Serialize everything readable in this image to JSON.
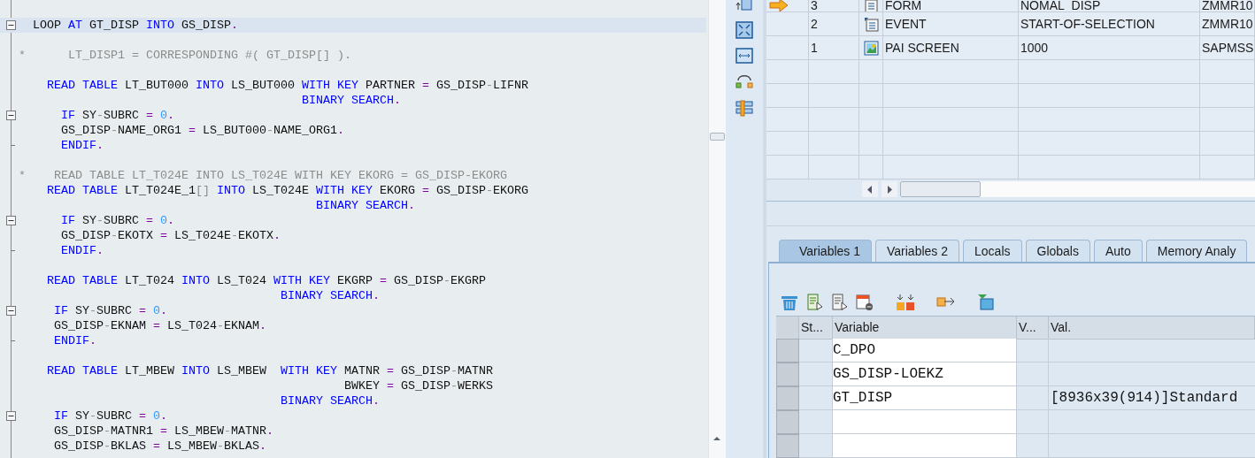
{
  "editor": {
    "lines": [
      {
        "kind": "code",
        "current": true,
        "fold_marker": true,
        "segments": [
          {
            "kind": "name",
            "text": "  LOOP "
          },
          {
            "kind": "keyword",
            "text": "AT"
          },
          {
            "kind": "name",
            "text": " GT_DISP "
          },
          {
            "kind": "keyword",
            "text": "INTO"
          },
          {
            "kind": "name",
            "text": " GS_DISP"
          },
          {
            "kind": "operator",
            "text": "."
          }
        ]
      },
      {
        "kind": "blank"
      },
      {
        "kind": "code",
        "segments": [
          {
            "kind": "comment",
            "text": "*      LT_DISP1 = CORRESPONDING #( GT_DISP[] )."
          }
        ]
      },
      {
        "kind": "blank"
      },
      {
        "kind": "code",
        "segments": [
          {
            "kind": "keyword",
            "text": "    READ TABLE"
          },
          {
            "kind": "name",
            "text": " LT_BUT000 "
          },
          {
            "kind": "keyword",
            "text": "INTO"
          },
          {
            "kind": "name",
            "text": " LS_BUT000 "
          },
          {
            "kind": "keyword",
            "text": "WITH KEY"
          },
          {
            "kind": "name",
            "text": " PARTNER "
          },
          {
            "kind": "operator",
            "text": "="
          },
          {
            "kind": "name",
            "text": " GS_DISP"
          },
          {
            "kind": "dash",
            "text": "-"
          },
          {
            "kind": "name",
            "text": "LIFNR"
          }
        ]
      },
      {
        "kind": "code",
        "segments": [
          {
            "kind": "keyword",
            "text": "                                        BINARY SEARCH"
          },
          {
            "kind": "operator",
            "text": "."
          }
        ]
      },
      {
        "kind": "code",
        "fold_marker": true,
        "segments": [
          {
            "kind": "keyword",
            "text": "      IF"
          },
          {
            "kind": "name",
            "text": " SY"
          },
          {
            "kind": "dash",
            "text": "-"
          },
          {
            "kind": "name",
            "text": "SUBRC "
          },
          {
            "kind": "operator",
            "text": "= "
          },
          {
            "kind": "number",
            "text": "0"
          },
          {
            "kind": "operator",
            "text": "."
          }
        ]
      },
      {
        "kind": "code",
        "segments": [
          {
            "kind": "name",
            "text": "      GS_DISP"
          },
          {
            "kind": "dash",
            "text": "-"
          },
          {
            "kind": "name",
            "text": "NAME_ORG1 "
          },
          {
            "kind": "operator",
            "text": "="
          },
          {
            "kind": "name",
            "text": " LS_BUT000"
          },
          {
            "kind": "dash",
            "text": "-"
          },
          {
            "kind": "name",
            "text": "NAME_ORG1"
          },
          {
            "kind": "operator",
            "text": "."
          }
        ]
      },
      {
        "kind": "code",
        "fold_end": true,
        "segments": [
          {
            "kind": "keyword",
            "text": "      ENDIF"
          },
          {
            "kind": "operator",
            "text": "."
          }
        ]
      },
      {
        "kind": "blank"
      },
      {
        "kind": "code",
        "segments": [
          {
            "kind": "comment",
            "text": "*    READ TABLE LT_T024E INTO LS_T024E WITH KEY EKORG = GS_DISP-EKORG"
          }
        ]
      },
      {
        "kind": "code",
        "segments": [
          {
            "kind": "keyword",
            "text": "    READ TABLE"
          },
          {
            "kind": "name",
            "text": " LT_T024E_1"
          },
          {
            "kind": "dash",
            "text": "[]"
          },
          {
            "kind": "keyword",
            "text": " INTO"
          },
          {
            "kind": "name",
            "text": " LS_T024E "
          },
          {
            "kind": "keyword",
            "text": "WITH KEY"
          },
          {
            "kind": "name",
            "text": " EKORG "
          },
          {
            "kind": "operator",
            "text": "="
          },
          {
            "kind": "name",
            "text": " GS_DISP"
          },
          {
            "kind": "dash",
            "text": "-"
          },
          {
            "kind": "name",
            "text": "EKORG"
          }
        ]
      },
      {
        "kind": "code",
        "segments": [
          {
            "kind": "keyword",
            "text": "                                          BINARY SEARCH"
          },
          {
            "kind": "operator",
            "text": "."
          }
        ]
      },
      {
        "kind": "code",
        "fold_marker": true,
        "segments": [
          {
            "kind": "keyword",
            "text": "      IF"
          },
          {
            "kind": "name",
            "text": " SY"
          },
          {
            "kind": "dash",
            "text": "-"
          },
          {
            "kind": "name",
            "text": "SUBRC "
          },
          {
            "kind": "operator",
            "text": "= "
          },
          {
            "kind": "number",
            "text": "0"
          },
          {
            "kind": "operator",
            "text": "."
          }
        ]
      },
      {
        "kind": "code",
        "segments": [
          {
            "kind": "name",
            "text": "      GS_DISP"
          },
          {
            "kind": "dash",
            "text": "-"
          },
          {
            "kind": "name",
            "text": "EKOTX "
          },
          {
            "kind": "operator",
            "text": "="
          },
          {
            "kind": "name",
            "text": " LS_T024E"
          },
          {
            "kind": "dash",
            "text": "-"
          },
          {
            "kind": "name",
            "text": "EKOTX"
          },
          {
            "kind": "operator",
            "text": "."
          }
        ]
      },
      {
        "kind": "code",
        "fold_end": true,
        "segments": [
          {
            "kind": "keyword",
            "text": "      ENDIF"
          },
          {
            "kind": "operator",
            "text": "."
          }
        ]
      },
      {
        "kind": "blank"
      },
      {
        "kind": "code",
        "segments": [
          {
            "kind": "keyword",
            "text": "    READ TABLE"
          },
          {
            "kind": "name",
            "text": " LT_T024 "
          },
          {
            "kind": "keyword",
            "text": "INTO"
          },
          {
            "kind": "name",
            "text": " LS_T024 "
          },
          {
            "kind": "keyword",
            "text": "WITH KEY"
          },
          {
            "kind": "name",
            "text": " EKGRP "
          },
          {
            "kind": "operator",
            "text": "="
          },
          {
            "kind": "name",
            "text": " GS_DISP"
          },
          {
            "kind": "dash",
            "text": "-"
          },
          {
            "kind": "name",
            "text": "EKGRP"
          }
        ]
      },
      {
        "kind": "code",
        "segments": [
          {
            "kind": "keyword",
            "text": "                                     BINARY SEARCH"
          },
          {
            "kind": "operator",
            "text": "."
          }
        ]
      },
      {
        "kind": "code",
        "fold_marker": true,
        "segments": [
          {
            "kind": "keyword",
            "text": "     IF"
          },
          {
            "kind": "name",
            "text": " SY"
          },
          {
            "kind": "dash",
            "text": "-"
          },
          {
            "kind": "name",
            "text": "SUBRC "
          },
          {
            "kind": "operator",
            "text": "= "
          },
          {
            "kind": "number",
            "text": "0"
          },
          {
            "kind": "operator",
            "text": "."
          }
        ]
      },
      {
        "kind": "code",
        "segments": [
          {
            "kind": "name",
            "text": "     GS_DISP"
          },
          {
            "kind": "dash",
            "text": "-"
          },
          {
            "kind": "name",
            "text": "EKNAM "
          },
          {
            "kind": "operator",
            "text": "="
          },
          {
            "kind": "name",
            "text": " LS_T024"
          },
          {
            "kind": "dash",
            "text": "-"
          },
          {
            "kind": "name",
            "text": "EKNAM"
          },
          {
            "kind": "operator",
            "text": "."
          }
        ]
      },
      {
        "kind": "code",
        "fold_end": true,
        "segments": [
          {
            "kind": "keyword",
            "text": "     ENDIF"
          },
          {
            "kind": "operator",
            "text": "."
          }
        ]
      },
      {
        "kind": "blank"
      },
      {
        "kind": "code",
        "segments": [
          {
            "kind": "keyword",
            "text": "    READ TABLE"
          },
          {
            "kind": "name",
            "text": " LT_MBEW "
          },
          {
            "kind": "keyword",
            "text": "INTO"
          },
          {
            "kind": "name",
            "text": " LS_MBEW  "
          },
          {
            "kind": "keyword",
            "text": "WITH KEY"
          },
          {
            "kind": "name",
            "text": " MATNR "
          },
          {
            "kind": "operator",
            "text": "="
          },
          {
            "kind": "name",
            "text": " GS_DISP"
          },
          {
            "kind": "dash",
            "text": "-"
          },
          {
            "kind": "name",
            "text": "MATNR"
          }
        ]
      },
      {
        "kind": "code",
        "segments": [
          {
            "kind": "name",
            "text": "                                              BWKEY "
          },
          {
            "kind": "operator",
            "text": "="
          },
          {
            "kind": "name",
            "text": " GS_DISP"
          },
          {
            "kind": "dash",
            "text": "-"
          },
          {
            "kind": "name",
            "text": "WERKS"
          }
        ]
      },
      {
        "kind": "code",
        "segments": [
          {
            "kind": "keyword",
            "text": "                                     BINARY SEARCH"
          },
          {
            "kind": "operator",
            "text": "."
          }
        ]
      },
      {
        "kind": "code",
        "fold_marker": true,
        "segments": [
          {
            "kind": "keyword",
            "text": "     IF"
          },
          {
            "kind": "name",
            "text": " SY"
          },
          {
            "kind": "dash",
            "text": "-"
          },
          {
            "kind": "name",
            "text": "SUBRC "
          },
          {
            "kind": "operator",
            "text": "= "
          },
          {
            "kind": "number",
            "text": "0"
          },
          {
            "kind": "operator",
            "text": "."
          }
        ]
      },
      {
        "kind": "code",
        "segments": [
          {
            "kind": "name",
            "text": "     GS_DISP"
          },
          {
            "kind": "dash",
            "text": "-"
          },
          {
            "kind": "name",
            "text": "MATNR1 "
          },
          {
            "kind": "operator",
            "text": "="
          },
          {
            "kind": "name",
            "text": " LS_MBEW"
          },
          {
            "kind": "dash",
            "text": "-"
          },
          {
            "kind": "name",
            "text": "MATNR"
          },
          {
            "kind": "operator",
            "text": "."
          }
        ]
      },
      {
        "kind": "code",
        "segments": [
          {
            "kind": "name",
            "text": "     GS_DISP"
          },
          {
            "kind": "dash",
            "text": "-"
          },
          {
            "kind": "name",
            "text": "BKLAS "
          },
          {
            "kind": "operator",
            "text": "="
          },
          {
            "kind": "name",
            "text": " LS_MBEW"
          },
          {
            "kind": "dash",
            "text": "-"
          },
          {
            "kind": "name",
            "text": "BKLAS"
          },
          {
            "kind": "operator",
            "text": "."
          }
        ]
      }
    ]
  },
  "call_stack": {
    "rows": [
      {
        "current": true,
        "level": "3",
        "kind": "form",
        "type": "FORM",
        "name": "NOMAL_DISP",
        "program": "ZMMR10"
      },
      {
        "level": "2",
        "kind": "event",
        "type": "EVENT",
        "name": "START-OF-SELECTION",
        "program": "ZMMR10"
      },
      {
        "level": "1",
        "kind": "screen",
        "type": "PAI SCREEN",
        "name": "1000",
        "program": "SAPMSS"
      }
    ]
  },
  "tabs": [
    {
      "label": "Variables 1",
      "selected": true
    },
    {
      "label": "Variables 2",
      "selected": false
    },
    {
      "label": "Locals",
      "selected": false
    },
    {
      "label": "Globals",
      "selected": false
    },
    {
      "label": "Auto",
      "selected": false
    },
    {
      "label": "Memory Analy",
      "selected": false
    }
  ],
  "variables": {
    "columns": [
      "St...",
      "Variable",
      "V...",
      "Val."
    ],
    "rows": [
      {
        "variable": "C_DPO"
      },
      {
        "variable": "GS_DISP-LOEKZ"
      },
      {
        "variable": "GT_DISP",
        "value": "[8936x39(914)]Standard"
      }
    ]
  }
}
